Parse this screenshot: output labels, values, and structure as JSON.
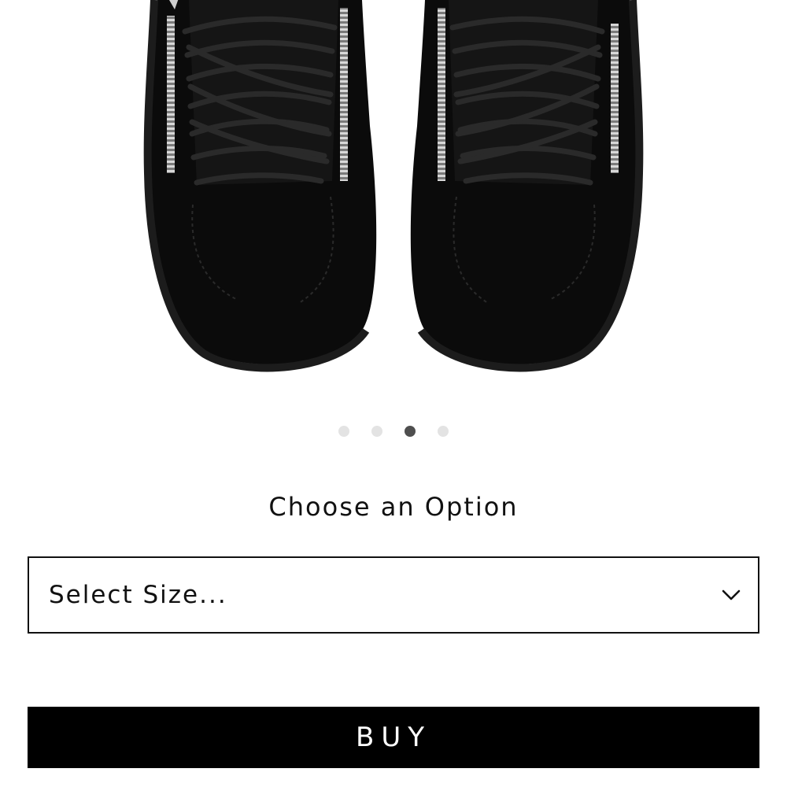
{
  "product": {
    "image_alt": "Black suede high-top sneakers with side zippers, top view",
    "carousel": {
      "total": 4,
      "active_index": 2
    }
  },
  "options": {
    "heading": "Choose an Option",
    "size_select": {
      "selected_text": "Select Size...",
      "icon": "chevron-down-icon"
    }
  },
  "actions": {
    "buy_label": "BUY"
  },
  "colors": {
    "button_bg": "#000000",
    "button_text": "#ffffff",
    "dot_inactive": "#e3e3e3",
    "dot_active": "#4f4f4f"
  }
}
